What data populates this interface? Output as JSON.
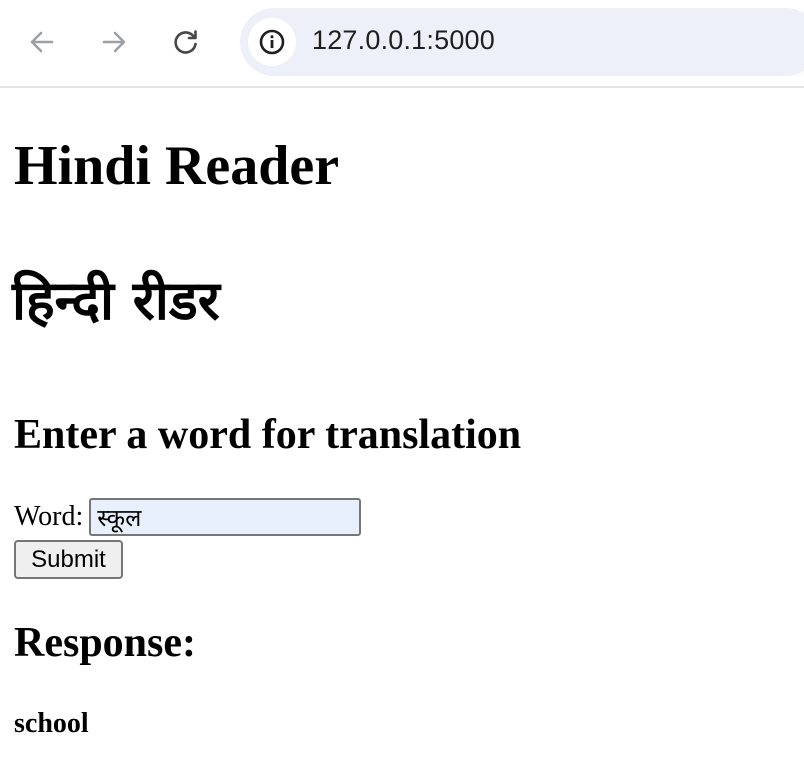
{
  "browser": {
    "url": "127.0.0.1:5000",
    "icons": {
      "back": "arrow-left-icon",
      "forward": "arrow-right-icon",
      "reload": "reload-icon",
      "site_info": "info-icon"
    }
  },
  "page": {
    "title_en": "Hindi Reader",
    "title_hi": "हिन्दी रीडर",
    "form_heading": "Enter a word for translation",
    "word_label": "Word:",
    "word_value": "स्कूल",
    "submit_label": "Submit",
    "response_heading": "Response:",
    "response_value": "school"
  },
  "colors": {
    "omnibox_bg": "#edf0f8",
    "input_autofill_bg": "#e8f0fe",
    "button_bg": "#efefef"
  }
}
